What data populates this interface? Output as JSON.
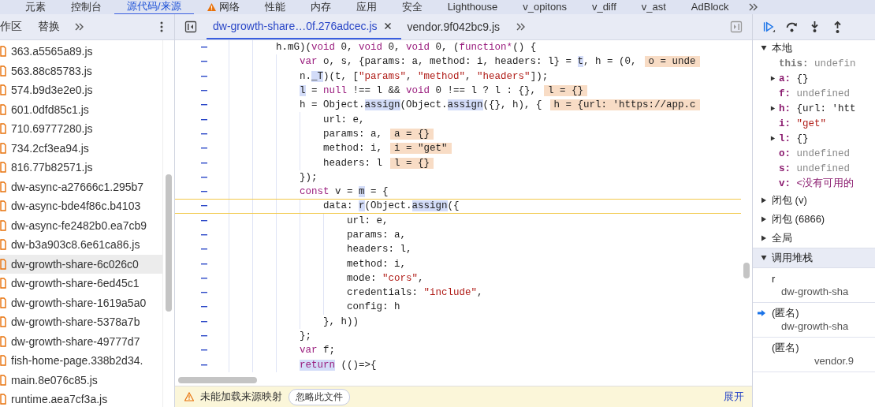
{
  "main_tabs": [
    {
      "label": "元素",
      "selected": false,
      "warning": false
    },
    {
      "label": "控制台",
      "selected": false,
      "warning": false
    },
    {
      "label": "源代码/来源",
      "selected": true,
      "warning": false
    },
    {
      "label": "网络",
      "selected": false,
      "warning": true
    },
    {
      "label": "性能",
      "selected": false,
      "warning": false
    },
    {
      "label": "内存",
      "selected": false,
      "warning": false
    },
    {
      "label": "应用",
      "selected": false,
      "warning": false
    },
    {
      "label": "安全",
      "selected": false,
      "warning": false
    },
    {
      "label": "Lighthouse",
      "selected": false,
      "warning": false
    },
    {
      "label": "v_opitons",
      "selected": false,
      "warning": false
    },
    {
      "label": "v_diff",
      "selected": false,
      "warning": false
    },
    {
      "label": "v_ast",
      "selected": false,
      "warning": false
    },
    {
      "label": "AdBlock",
      "selected": false,
      "warning": false
    }
  ],
  "navigator": {
    "tabs": [
      {
        "label": "作区",
        "selected": false
      },
      {
        "label": "替换",
        "selected": false
      }
    ],
    "files": [
      {
        "name": "363.a5565a89.js",
        "selected": false
      },
      {
        "name": "563.88c85783.js",
        "selected": false
      },
      {
        "name": "574.b9d3e2e0.js",
        "selected": false
      },
      {
        "name": "601.0dfd85c1.js",
        "selected": false
      },
      {
        "name": "710.69777280.js",
        "selected": false
      },
      {
        "name": "734.2cf3ea94.js",
        "selected": false
      },
      {
        "name": "816.77b82571.js",
        "selected": false
      },
      {
        "name": "dw-async-a27666c1.295b7",
        "selected": false
      },
      {
        "name": "dw-async-bde4f86c.b4103",
        "selected": false
      },
      {
        "name": "dw-async-fe2482b0.ea7cb9",
        "selected": false
      },
      {
        "name": "dw-b3a903c8.6e61ca86.js",
        "selected": false
      },
      {
        "name": "dw-growth-share-6c026c0",
        "selected": true
      },
      {
        "name": "dw-growth-share-6ed45c1",
        "selected": false
      },
      {
        "name": "dw-growth-share-1619a5a0",
        "selected": false
      },
      {
        "name": "dw-growth-share-5378a7b",
        "selected": false
      },
      {
        "name": "dw-growth-share-49777d7",
        "selected": false
      },
      {
        "name": "fish-home-page.338b2d34.",
        "selected": false
      },
      {
        "name": "main.8e076c85.js",
        "selected": false
      },
      {
        "name": "runtime.aea7cf3a.js",
        "selected": false
      }
    ]
  },
  "editor": {
    "tabs": [
      {
        "label": "dw-growth-share…0f.276adcec.js",
        "selected": true,
        "closable": true
      },
      {
        "label": "vendor.9f042bc9.js",
        "selected": false,
        "closable": false
      }
    ],
    "lines": [
      {
        "current": false,
        "tokens": [
          {
            "kind": "plain",
            "t": "h.mG)("
          },
          {
            "kind": "kw",
            "t": "void"
          },
          {
            "kind": "plain",
            "t": " 0, "
          },
          {
            "kind": "kw",
            "t": "void"
          },
          {
            "kind": "plain",
            "t": " 0, "
          },
          {
            "kind": "kw",
            "t": "void"
          },
          {
            "kind": "plain",
            "t": " 0, ("
          },
          {
            "kind": "kw",
            "t": "function*"
          },
          {
            "kind": "plain",
            "t": "() {"
          }
        ],
        "children": [
          {
            "current": false,
            "tokens": [
              {
                "kind": "kw",
                "t": "var"
              },
              {
                "kind": "plain",
                "t": " o, s, {params: a, method: i, headers: l} = "
              },
              {
                "kind": "hl",
                "t": "t"
              },
              {
                "kind": "plain",
                "t": ", h = (0,"
              }
            ],
            "badge": "o = unde"
          },
          {
            "current": false,
            "tokens": [
              {
                "kind": "plain",
                "t": "n."
              },
              {
                "kind": "hl",
                "t": "_T"
              },
              {
                "kind": "plain",
                "t": ")(t, ["
              },
              {
                "kind": "str",
                "t": "\"params\""
              },
              {
                "kind": "plain",
                "t": ", "
              },
              {
                "kind": "str",
                "t": "\"method\""
              },
              {
                "kind": "plain",
                "t": ", "
              },
              {
                "kind": "str",
                "t": "\"headers\""
              },
              {
                "kind": "plain",
                "t": "]);"
              }
            ]
          },
          {
            "current": false,
            "tokens": [
              {
                "kind": "hl",
                "t": "l"
              },
              {
                "kind": "plain",
                "t": " = "
              },
              {
                "kind": "kw",
                "t": "null"
              },
              {
                "kind": "plain",
                "t": " !== l && "
              },
              {
                "kind": "kw",
                "t": "void"
              },
              {
                "kind": "plain",
                "t": " 0 !== l ? l : {},"
              }
            ],
            "badge": "l = {}"
          },
          {
            "current": false,
            "tokens": [
              {
                "kind": "plain",
                "t": "h = Object."
              },
              {
                "kind": "hl",
                "t": "assign"
              },
              {
                "kind": "plain",
                "t": "(Object."
              },
              {
                "kind": "hl",
                "t": "assign"
              },
              {
                "kind": "plain",
                "t": "({}, h), {"
              }
            ],
            "badge": "h = {url: 'https://app.c",
            "children": [
              {
                "current": false,
                "tokens": [
                  {
                    "kind": "plain",
                    "t": "url: e,"
                  }
                ]
              },
              {
                "current": false,
                "tokens": [
                  {
                    "kind": "plain",
                    "t": "params: a,"
                  }
                ],
                "badge": "a = {}"
              },
              {
                "current": false,
                "tokens": [
                  {
                    "kind": "plain",
                    "t": "method: i,"
                  }
                ],
                "badge": "i = \"get\""
              },
              {
                "current": false,
                "tokens": [
                  {
                    "kind": "plain",
                    "t": "headers: l"
                  }
                ],
                "badge": "l = {}"
              }
            ]
          },
          {
            "current": false,
            "tokens": [
              {
                "kind": "plain",
                "t": "});"
              }
            ]
          },
          {
            "current": false,
            "tokens": [
              {
                "kind": "kw",
                "t": "const"
              },
              {
                "kind": "plain",
                "t": " v = "
              },
              {
                "kind": "hl",
                "t": "m"
              },
              {
                "kind": "plain",
                "t": " = {"
              }
            ],
            "children": [
              {
                "current": true,
                "tokens": [
                  {
                    "kind": "plain",
                    "t": "data: "
                  },
                  {
                    "kind": "hl",
                    "t": "r"
                  },
                  {
                    "kind": "plain",
                    "t": "(Object."
                  },
                  {
                    "kind": "hl",
                    "t": "assign"
                  },
                  {
                    "kind": "plain",
                    "t": "({"
                  }
                ],
                "children": [
                  {
                    "current": false,
                    "tokens": [
                      {
                        "kind": "plain",
                        "t": "url: e,"
                      }
                    ]
                  },
                  {
                    "current": false,
                    "tokens": [
                      {
                        "kind": "plain",
                        "t": "params: a,"
                      }
                    ]
                  },
                  {
                    "current": false,
                    "tokens": [
                      {
                        "kind": "plain",
                        "t": "headers: l,"
                      }
                    ]
                  },
                  {
                    "current": false,
                    "tokens": [
                      {
                        "kind": "plain",
                        "t": "method: i,"
                      }
                    ]
                  },
                  {
                    "current": false,
                    "tokens": [
                      {
                        "kind": "plain",
                        "t": "mode: "
                      },
                      {
                        "kind": "str",
                        "t": "\"cors\""
                      },
                      {
                        "kind": "plain",
                        "t": ","
                      }
                    ]
                  },
                  {
                    "current": false,
                    "tokens": [
                      {
                        "kind": "plain",
                        "t": "credentials: "
                      },
                      {
                        "kind": "str",
                        "t": "\"include\""
                      },
                      {
                        "kind": "plain",
                        "t": ","
                      }
                    ]
                  },
                  {
                    "current": false,
                    "tokens": [
                      {
                        "kind": "plain",
                        "t": "config: h"
                      }
                    ]
                  }
                ]
              },
              {
                "current": false,
                "tokens": [
                  {
                    "kind": "plain",
                    "t": "}, h))"
                  }
                ]
              }
            ]
          },
          {
            "current": false,
            "tokens": [
              {
                "kind": "plain",
                "t": "};"
              }
            ]
          },
          {
            "current": false,
            "tokens": [
              {
                "kind": "kw",
                "t": "var"
              },
              {
                "kind": "plain",
                "t": " f;"
              }
            ]
          },
          {
            "current": false,
            "tokens": [
              {
                "kind": "kwhl",
                "t": "return"
              },
              {
                "kind": "plain",
                "t": " (()=>{"
              }
            ]
          }
        ]
      }
    ],
    "warning_bar": {
      "message": "未能加载来源映射",
      "button": "忽略此文件",
      "link": "展开"
    }
  },
  "debugger": {
    "scope": {
      "title": "本地",
      "expanded": true,
      "variables": [
        {
          "name": "this:",
          "value": "undefin",
          "kind": "undefined",
          "expandable": false
        },
        {
          "name": "a:",
          "value": "{}",
          "kind": "object",
          "expandable": true
        },
        {
          "name": "f:",
          "value": "undefined",
          "kind": "undefined",
          "expandable": false
        },
        {
          "name": "h:",
          "value": "{url: 'htt",
          "kind": "object",
          "expandable": true
        },
        {
          "name": "i:",
          "value": "\"get\"",
          "kind": "string",
          "expandable": false
        },
        {
          "name": "l:",
          "value": "{}",
          "kind": "object",
          "expandable": true
        },
        {
          "name": "o:",
          "value": "undefined",
          "kind": "undefined",
          "expandable": false
        },
        {
          "name": "s:",
          "value": "undefined",
          "kind": "undefined",
          "expandable": false
        },
        {
          "name": "v:",
          "value": "<没有可用的",
          "kind": "unavailable",
          "expandable": false
        }
      ]
    },
    "sections": [
      {
        "title": "闭包 (v)",
        "expanded": false
      },
      {
        "title": "闭包 (6866)",
        "expanded": false
      },
      {
        "title": "全局",
        "expanded": false
      }
    ],
    "call_stack": {
      "title": "调用堆栈",
      "expanded": true,
      "frames": [
        {
          "function": "r",
          "location": "dw-growth-sha",
          "current": false
        },
        {
          "function": "(匿名)",
          "location": "dw-growth-sha",
          "current": true
        },
        {
          "function": "(匿名)",
          "location": "vendor.9",
          "current": false
        }
      ]
    }
  }
}
